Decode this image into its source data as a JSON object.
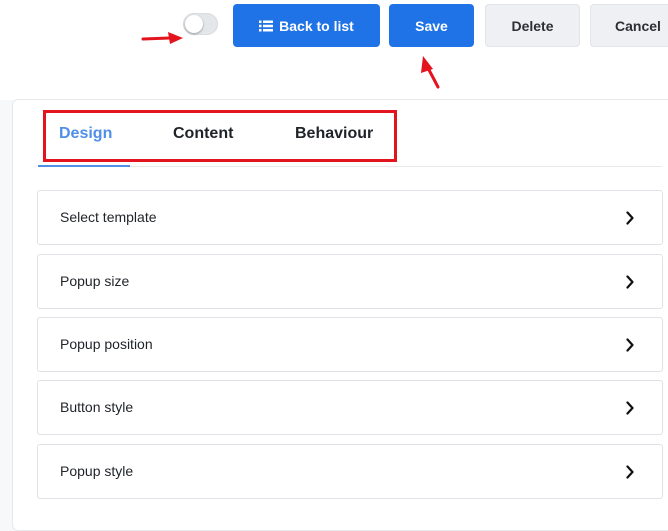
{
  "toolbar": {
    "toggle_state": "off",
    "back_label": "Back to list",
    "save_label": "Save",
    "delete_label": "Delete",
    "cancel_label": "Cancel",
    "back_icon": "list-icon"
  },
  "tabs": [
    {
      "label": "Design",
      "active": true
    },
    {
      "label": "Content",
      "active": false
    },
    {
      "label": "Behaviour",
      "active": false
    }
  ],
  "sections": [
    {
      "label": "Select template",
      "icon": "chevron-right-icon"
    },
    {
      "label": "Popup size",
      "icon": "chevron-right-icon"
    },
    {
      "label": "Popup position",
      "icon": "chevron-right-icon"
    },
    {
      "label": "Button style",
      "icon": "chevron-right-icon"
    },
    {
      "label": "Popup style",
      "icon": "chevron-right-icon"
    }
  ],
  "annotations": {
    "color": "#e3141e",
    "arrows": [
      "arrow-to-toggle",
      "arrow-to-save"
    ],
    "box": "tabs-highlight"
  },
  "colors": {
    "primary": "#1f73e6",
    "tab_active": "#4f8fe8",
    "light_button": "#eef0f3"
  }
}
